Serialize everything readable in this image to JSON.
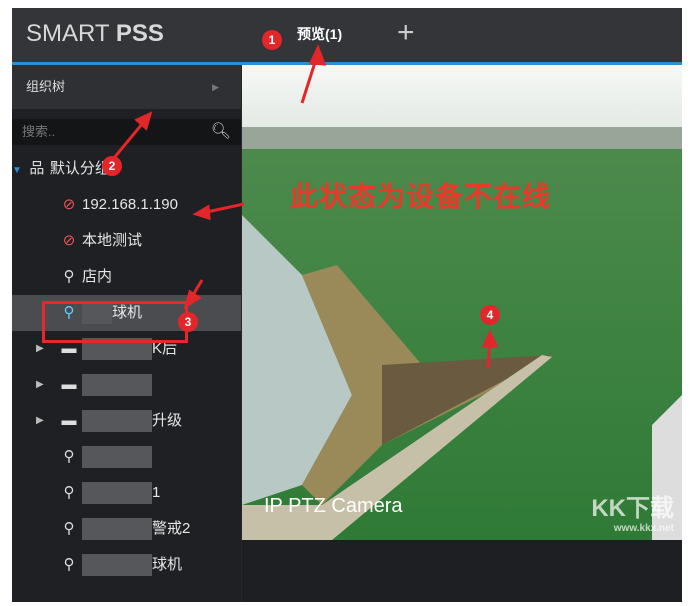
{
  "header": {
    "logo_light": "SMART ",
    "logo_bold": "PSS",
    "tab": "预览(1)",
    "add": "+"
  },
  "sidebar": {
    "title": "组织树",
    "search_placeholder": "搜索..",
    "root": "默认分组",
    "items": [
      {
        "label": "192.168.1.190",
        "icon": "device-offline-icon"
      },
      {
        "label": "本地测试",
        "icon": "device-offline-icon"
      },
      {
        "label": "店内",
        "icon": "camera-icon"
      },
      {
        "label": "球机",
        "icon": "camera-online-icon"
      },
      {
        "label": "K后",
        "icon": "nvr-icon"
      },
      {
        "label": "",
        "icon": "nvr-icon"
      },
      {
        "label": "升级",
        "icon": "nvr-icon"
      },
      {
        "label": "",
        "icon": "camera-icon"
      },
      {
        "label": "1",
        "icon": "camera-icon"
      },
      {
        "label": "警戒2",
        "icon": "camera-icon"
      },
      {
        "label": "球机",
        "icon": "camera-icon"
      }
    ]
  },
  "video": {
    "camera_label": "IP PTZ Camera"
  },
  "annotations": {
    "offline_note": "此状态为设备不在线",
    "badges": [
      "1",
      "2",
      "3",
      "4"
    ]
  },
  "watermark": {
    "text": "KK下载",
    "url": "www.kkx.net"
  },
  "colors": {
    "accent": "#2a8fd0",
    "annotation": "#e2262a"
  }
}
